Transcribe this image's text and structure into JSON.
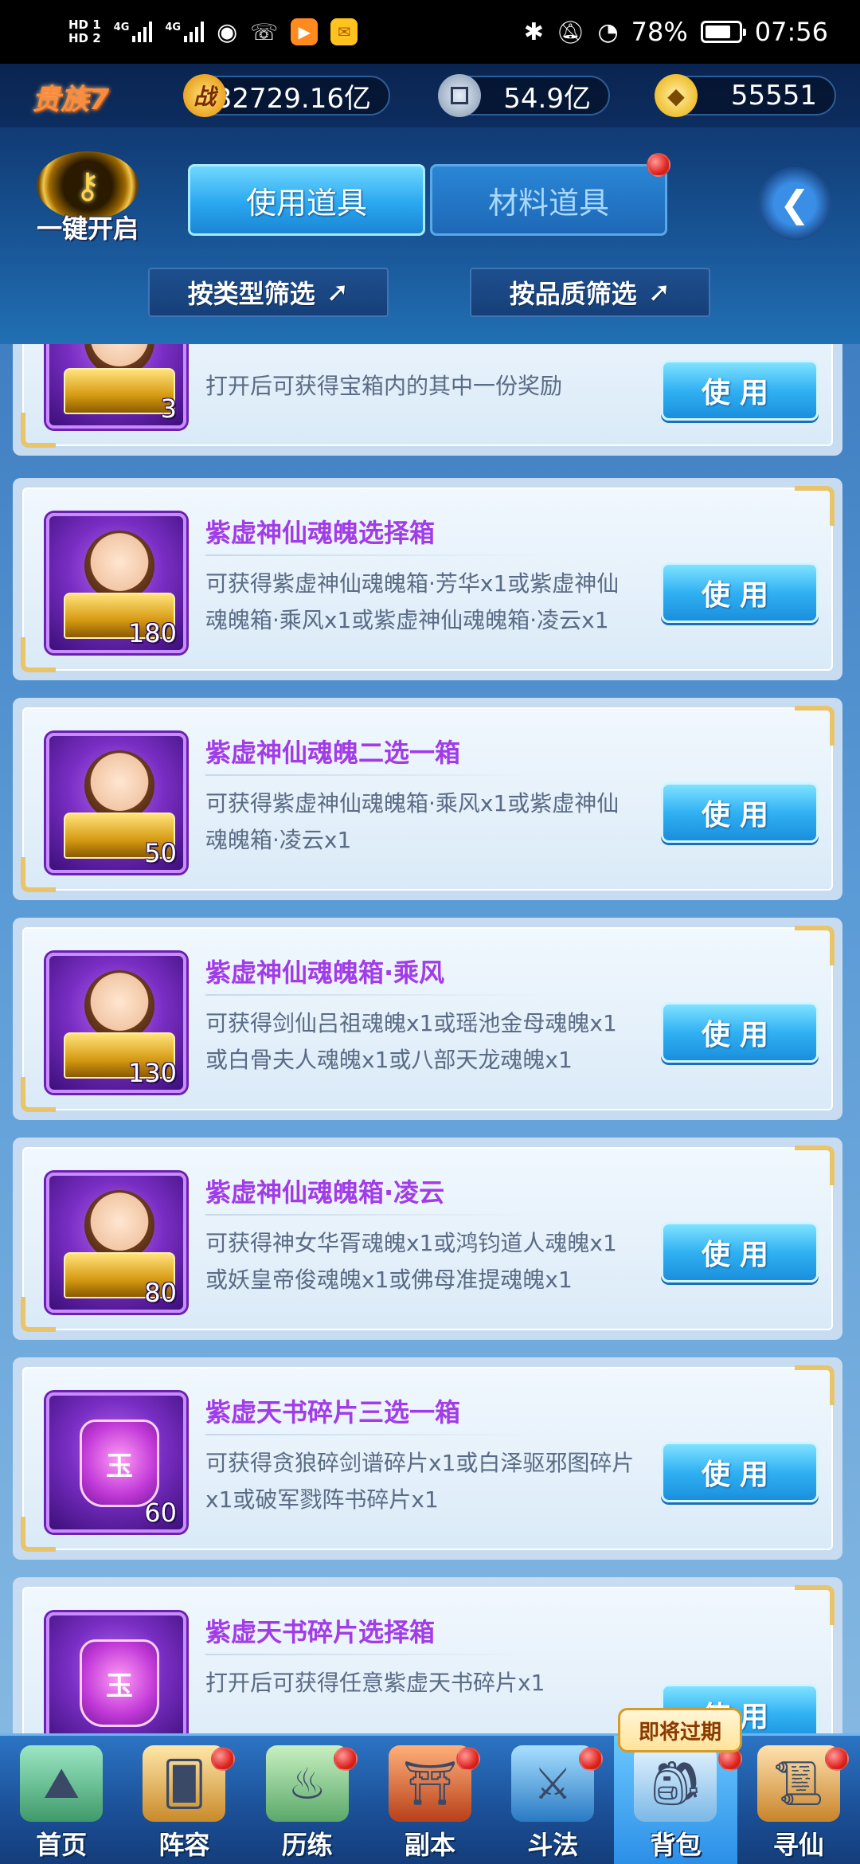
{
  "status_bar": {
    "hd_top": "HD 1",
    "hd_bottom": "HD 2",
    "net1": "4G",
    "net2": "4G",
    "battery": "78%",
    "time": "07:56"
  },
  "resources": {
    "vip": "贵族7",
    "power_glyph": "战",
    "power": "132729.16亿",
    "coins": "54.9亿",
    "gold": "55551"
  },
  "header": {
    "one_key_open": "一键开启",
    "tabs": [
      {
        "label": "使用道具",
        "active": true
      },
      {
        "label": "材料道具",
        "active": false,
        "has_dot": true
      }
    ],
    "filter_type": "按类型筛选",
    "filter_quality": "按品质筛选",
    "back_icon": "back-arrow-icon"
  },
  "items": [
    {
      "name": "",
      "count": "3",
      "desc": "打开后可获得宝箱内的其中一份奖励",
      "icon": "chest-icon",
      "use": "使用"
    },
    {
      "name": "紫虚神仙魂魄选择箱",
      "count": "180",
      "desc": "可获得紫虚神仙魂魄箱·芳华x1或紫虚神仙魂魄箱·乘风x1或紫虚神仙魂魄箱·凌云x1",
      "icon": "chest-icon",
      "use": "使用"
    },
    {
      "name": "紫虚神仙魂魄二选一箱",
      "count": "50",
      "desc": "可获得紫虚神仙魂魄箱·乘风x1或紫虚神仙魂魄箱·凌云x1",
      "icon": "chest-icon",
      "use": "使用"
    },
    {
      "name": "紫虚神仙魂魄箱·乘风",
      "count": "130",
      "desc": "可获得剑仙吕祖魂魄x1或瑶池金母魂魄x1或白骨夫人魂魄x1或八部天龙魂魄x1",
      "icon": "chest-icon",
      "use": "使用"
    },
    {
      "name": "紫虚神仙魂魄箱·凌云",
      "count": "80",
      "desc": "可获得神女华胥魂魄x1或鸿钧道人魂魄x1或妖皇帝俊魂魄x1或佛母准提魂魄x1",
      "icon": "chest-icon",
      "use": "使用"
    },
    {
      "name": "紫虚天书碎片三选一箱",
      "count": "60",
      "desc": "可获得贪狼碎剑谱碎片x1或白泽驱邪图碎片x1或破军戮阵书碎片x1",
      "icon": "bag-icon",
      "use": "使用"
    },
    {
      "name": "紫虚天书碎片选择箱",
      "count": "",
      "desc": "打开后可获得任意紫虚天书碎片x1",
      "icon": "bag-icon",
      "use": "使用"
    }
  ],
  "bag_glyph": "玉",
  "nav": {
    "expire_badge": "即将过期",
    "items": [
      {
        "label": "首页",
        "icon": "home-island-icon",
        "dot": false
      },
      {
        "label": "阵容",
        "icon": "lineup-cards-icon",
        "dot": true
      },
      {
        "label": "历练",
        "icon": "training-gourd-icon",
        "dot": true
      },
      {
        "label": "副本",
        "icon": "dungeon-gate-icon",
        "dot": true
      },
      {
        "label": "斗法",
        "icon": "battle-sword-icon",
        "dot": true
      },
      {
        "label": "背包",
        "icon": "backpack-icon",
        "dot": true,
        "active": true
      },
      {
        "label": "寻仙",
        "icon": "quest-scroll-icon",
        "dot": true
      }
    ]
  },
  "colors": {
    "item_name": "#a13ce8",
    "use_button": "#31b1f3",
    "notification": "#e0261e"
  }
}
